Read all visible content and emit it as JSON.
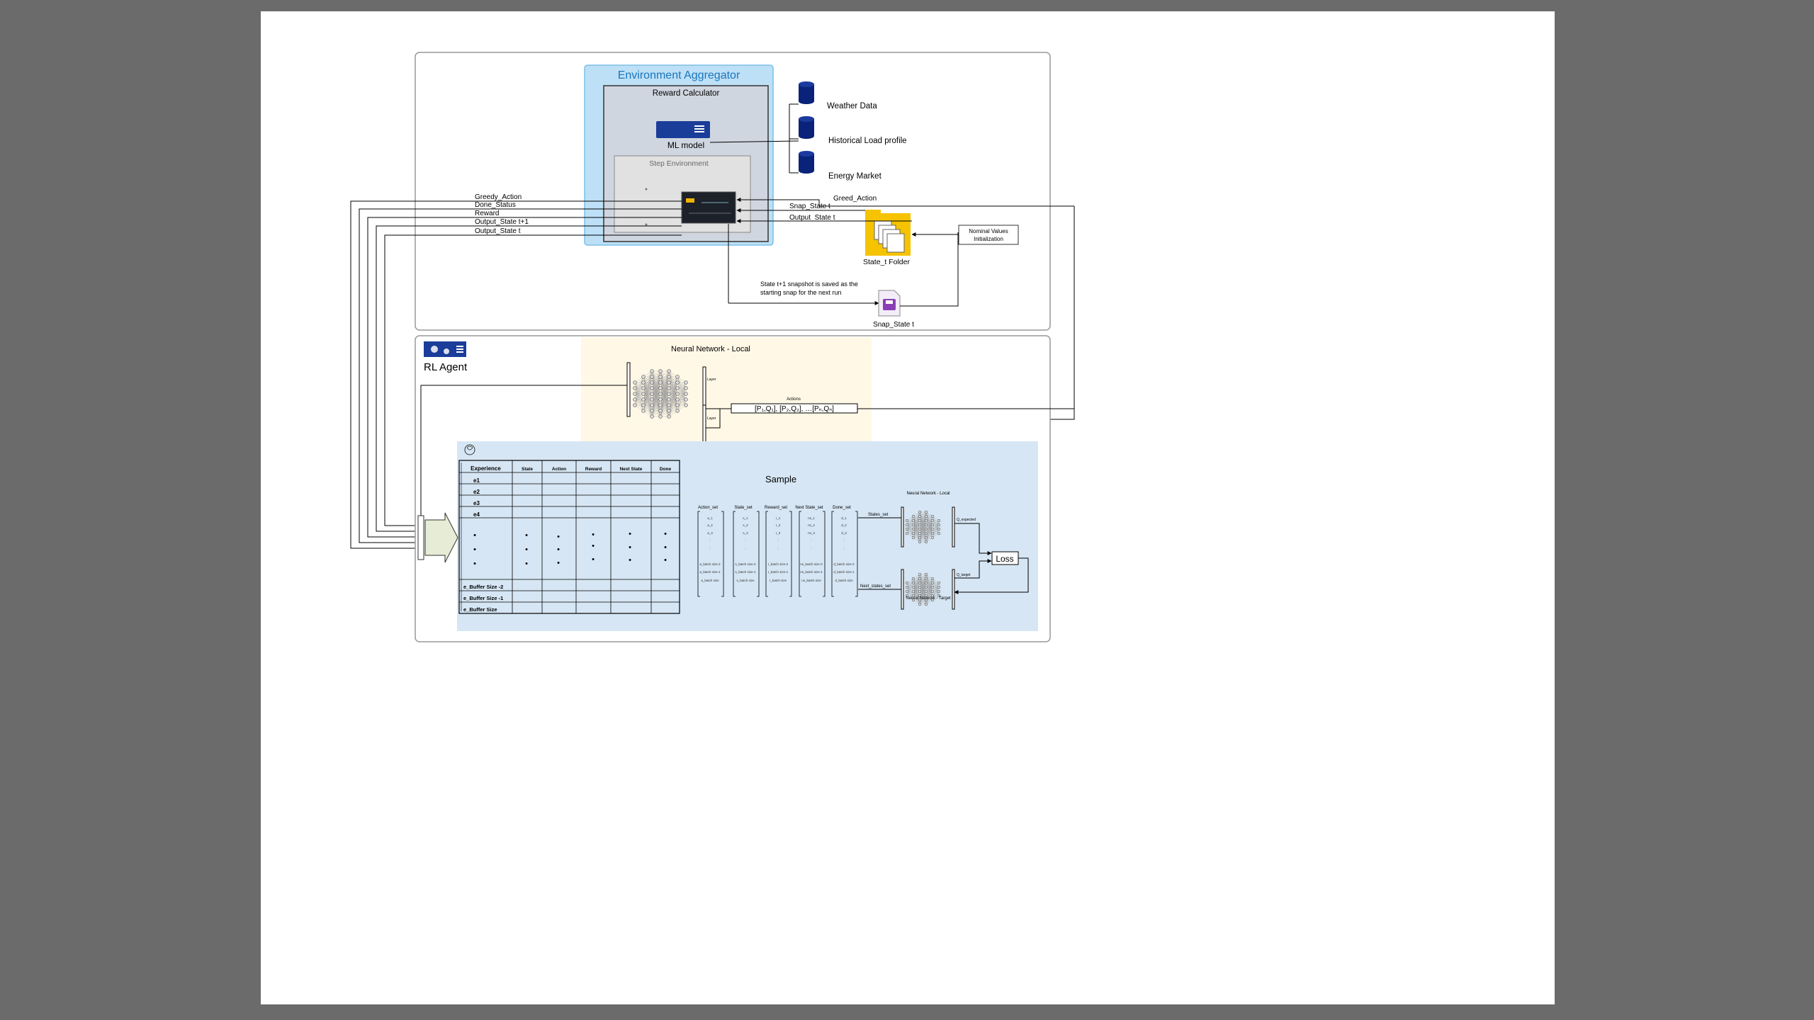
{
  "environment": {
    "aggregator_title": "Environment Aggregator",
    "reward_calculator_title": "Reward Calculator",
    "ml_model_label": "ML model",
    "step_environment_title": "Step Environment",
    "data_sources": [
      "Weather Data",
      "Historical Load profile",
      "Energy Market"
    ],
    "state_folder_label": "State_t Folder",
    "nominal_values_label": [
      "Nominal Values",
      "Initialization"
    ],
    "snap_state_label": "Snap_State t",
    "snapshot_note": [
      "State t+1 snapshot is saved as the",
      "starting snap for the next run"
    ]
  },
  "signals": {
    "left": [
      "Greedy_Action",
      "Done_Status",
      "Reward",
      "Output_State t+1",
      "Output_State t"
    ],
    "greed_action": "Greed_Action",
    "snap_state": "Snap_State t",
    "output_state": "Output_State t"
  },
  "agent": {
    "title": "RL Agent",
    "nn_local_title": "Neural Network - Local",
    "nn_small_labels": [
      "Layer",
      "Layer"
    ],
    "actions_label": "Actions",
    "actions_formula": "[P₁,Q₁], [P₂,Q₂], …[Pₙ,Qₙ]"
  },
  "replay_buffer": {
    "headers": [
      "Experience",
      "State",
      "Action",
      "Reward",
      "Next State",
      "Done"
    ],
    "top_rows": [
      "e1",
      "e2",
      "e3",
      "e4"
    ],
    "dots": "•",
    "bottom_rows": [
      "e_Buffer Size -2",
      "e_Buffer Size -1",
      "e_Buffer Size"
    ]
  },
  "sample": {
    "title": "Sample",
    "sets": [
      "Action_set",
      "State_set",
      "Reward_set",
      "Next State_set",
      "Done_set"
    ],
    "col_entries": [
      [
        "a_1",
        "a_2",
        "a_3",
        ":",
        ":",
        "a_batch size-2",
        "a_batch size-1",
        "a_batch size"
      ],
      [
        "s_1",
        "s_2",
        "s_3",
        ":",
        ":",
        "s_batch size-2",
        "s_batch size-1",
        "s_batch size"
      ],
      [
        "r_1",
        "r_2",
        "r_3",
        ":",
        ":",
        "r_batch size-2",
        "r_batch size-1",
        "r_batch size"
      ],
      [
        "ns_1",
        "ns_2",
        "ns_3",
        ":",
        ":",
        "ns_batch size-2",
        "ns_batch size-1",
        "ns_batch size"
      ],
      [
        "d_1",
        "d_2",
        "d_3",
        ":",
        ":",
        "d_batch size-2",
        "d_batch size-1",
        "d_batch size"
      ]
    ],
    "states_set_label": "States_set",
    "next_states_set_label": "Next_states_set",
    "nn_local_label": "Neural Network - Local",
    "nn_target_label": "Neural Network - Target",
    "q_expected_label": "Q_expected",
    "q_target_label": "Q_target",
    "loss_label": "Loss"
  }
}
